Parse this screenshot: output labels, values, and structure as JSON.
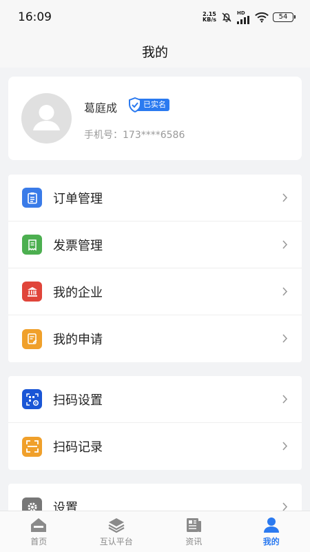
{
  "status_bar": {
    "time": "16:09",
    "net_speed_value": "2.15",
    "net_speed_unit": "KB/s",
    "hd_label": "HD",
    "battery": "54"
  },
  "header": {
    "title": "我的"
  },
  "profile": {
    "name": "葛庭成",
    "verified_label": "已实名",
    "phone_label": "手机号：",
    "phone_value": "173****6586"
  },
  "menu_group_1": [
    {
      "label": "订单管理",
      "icon": "clipboard-icon",
      "color": "#3a7be8"
    },
    {
      "label": "发票管理",
      "icon": "receipt-icon",
      "color": "#4caf50"
    },
    {
      "label": "我的企业",
      "icon": "bank-icon",
      "color": "#e0453a"
    },
    {
      "label": "我的申请",
      "icon": "document-edit-icon",
      "color": "#f0a02b"
    }
  ],
  "menu_group_2": [
    {
      "label": "扫码设置",
      "icon": "qr-settings-icon",
      "color": "#1a56d6"
    },
    {
      "label": "扫码记录",
      "icon": "scan-icon",
      "color": "#f0a02b"
    }
  ],
  "menu_group_3": [
    {
      "label": "设置",
      "icon": "gear-icon",
      "color": "#777777"
    }
  ],
  "tabs": [
    {
      "label": "首页",
      "icon": "home-icon"
    },
    {
      "label": "互认平台",
      "icon": "layers-icon"
    },
    {
      "label": "资讯",
      "icon": "news-icon"
    },
    {
      "label": "我的",
      "icon": "user-icon",
      "active": true
    }
  ],
  "colors": {
    "accent": "#2b7af0",
    "background": "#f2f3f5"
  }
}
